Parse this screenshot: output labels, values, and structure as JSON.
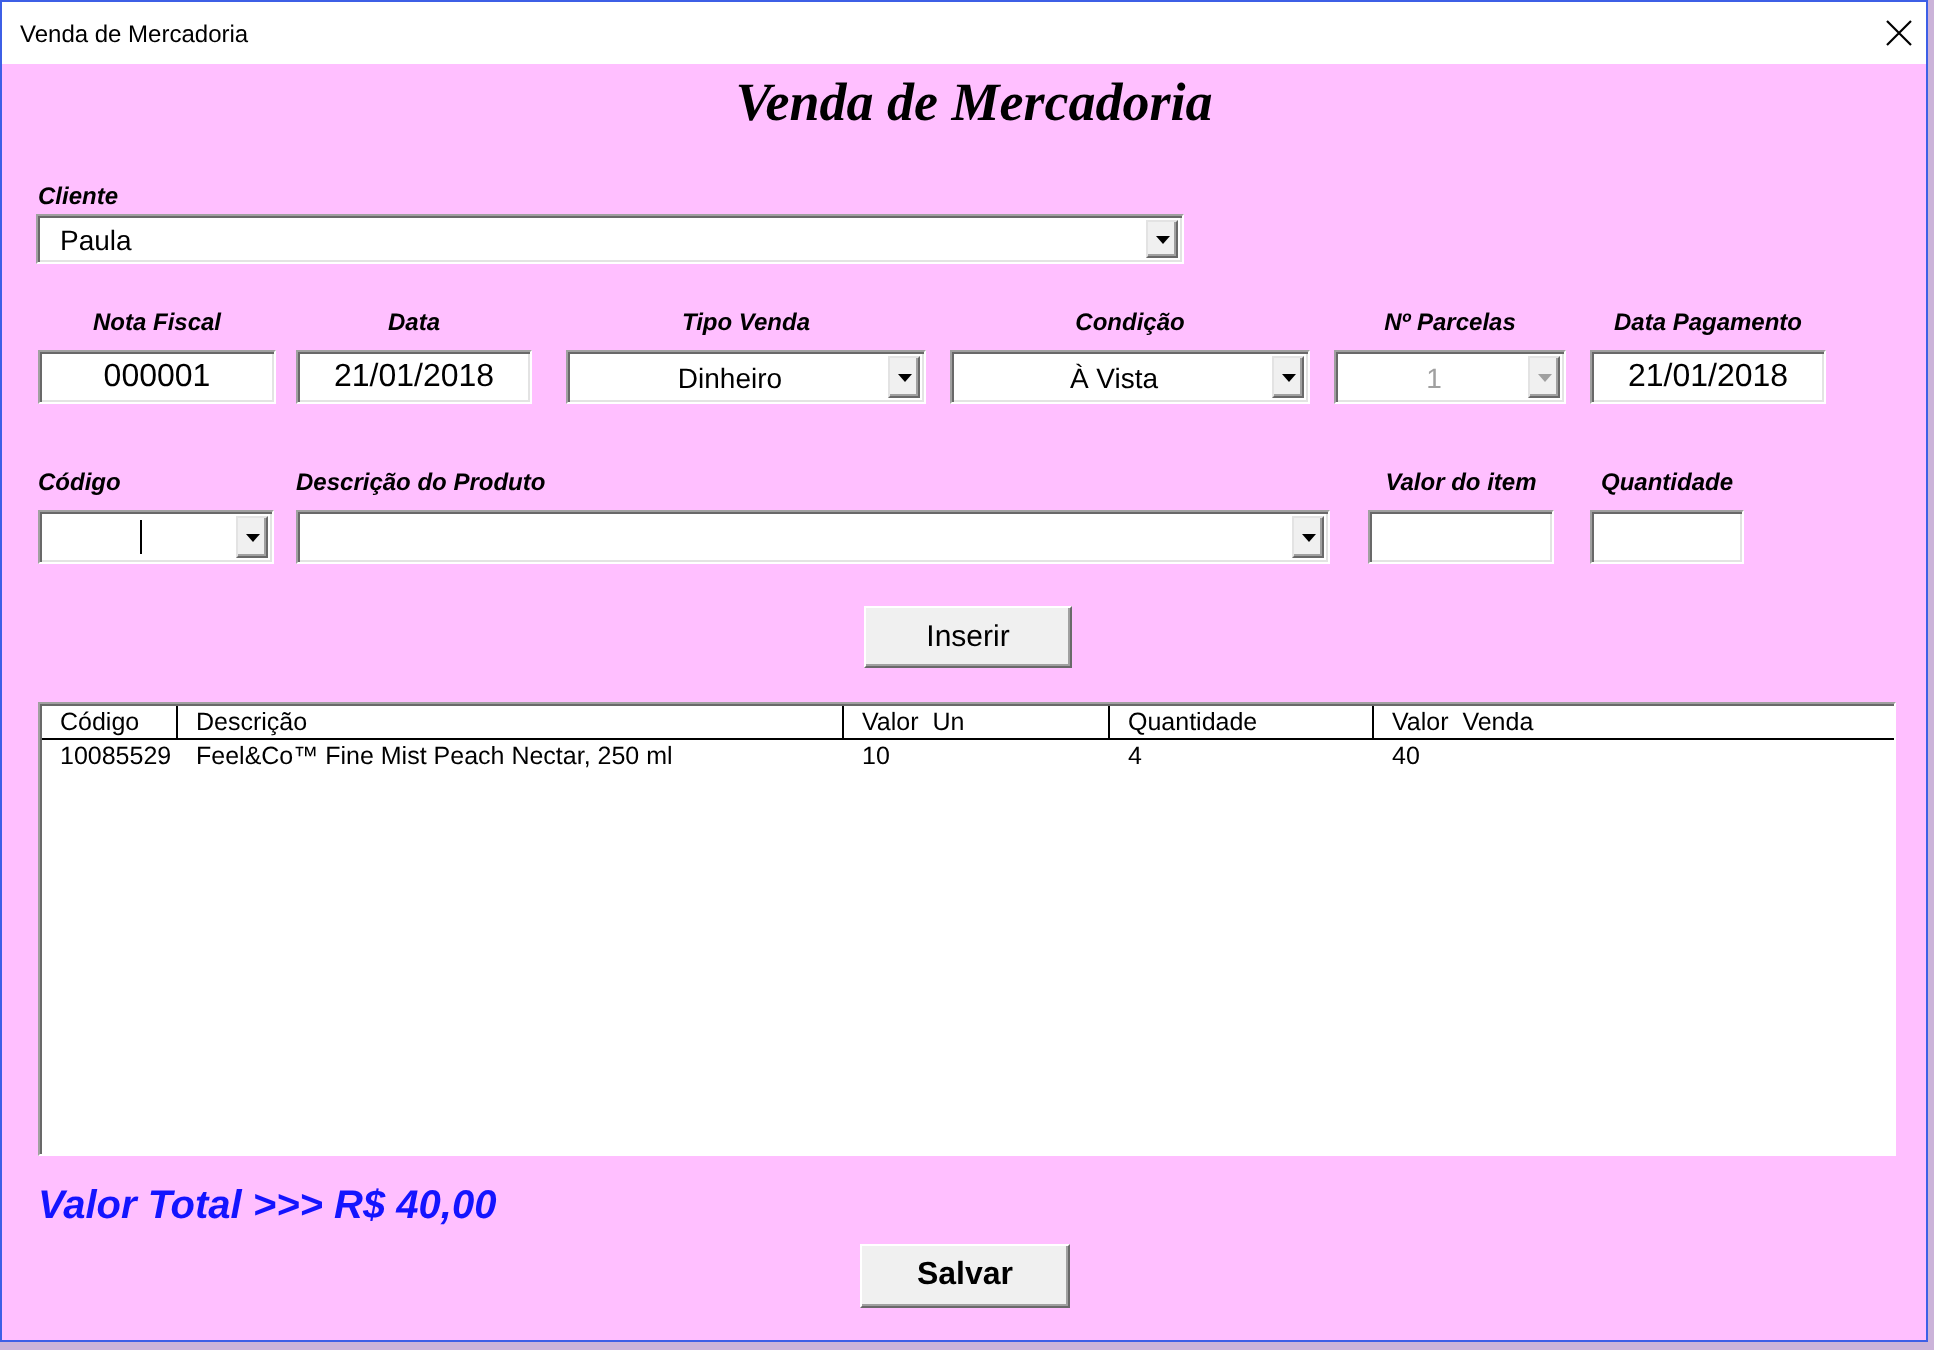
{
  "window": {
    "title": "Venda de Mercadoria"
  },
  "heading": "Venda de Mercadoria",
  "cliente": {
    "label": "Cliente",
    "value": "Paula"
  },
  "sale_fields": [
    {
      "label": "Nota Fiscal",
      "kind": "text",
      "value": "000001",
      "disabled": false
    },
    {
      "label": "Data",
      "kind": "text",
      "value": "21/01/2018",
      "disabled": false
    },
    {
      "label": "Tipo Venda",
      "kind": "combo",
      "value": "Dinheiro",
      "disabled": false
    },
    {
      "label": "Condição",
      "kind": "combo",
      "value": "À Vista",
      "disabled": false
    },
    {
      "label": "Nº Parcelas",
      "kind": "combo",
      "value": "1",
      "disabled": true
    },
    {
      "label": "Data Pagamento",
      "kind": "text",
      "value": "21/01/2018",
      "disabled": false
    }
  ],
  "item_fields": [
    {
      "label": "Código",
      "kind": "combo",
      "focused": true
    },
    {
      "label": "Descrição do Produto",
      "kind": "combo",
      "focused": false
    },
    {
      "label": "Valor do item",
      "kind": "text",
      "focused": false
    },
    {
      "label": "Quantidade",
      "kind": "text",
      "focused": false
    }
  ],
  "insert_button": "Inserir",
  "table": {
    "columns": [
      "Código",
      "Descrição",
      "Valor  Un",
      "Quantidade",
      "Valor  Venda"
    ],
    "rows": [
      [
        "10085529",
        "Feel&Co™ Fine Mist Peach Nectar, 250 ml",
        "10",
        "4",
        "40"
      ]
    ]
  },
  "total": "Valor Total >>> R$ 40,00",
  "save_button": "Salvar"
}
